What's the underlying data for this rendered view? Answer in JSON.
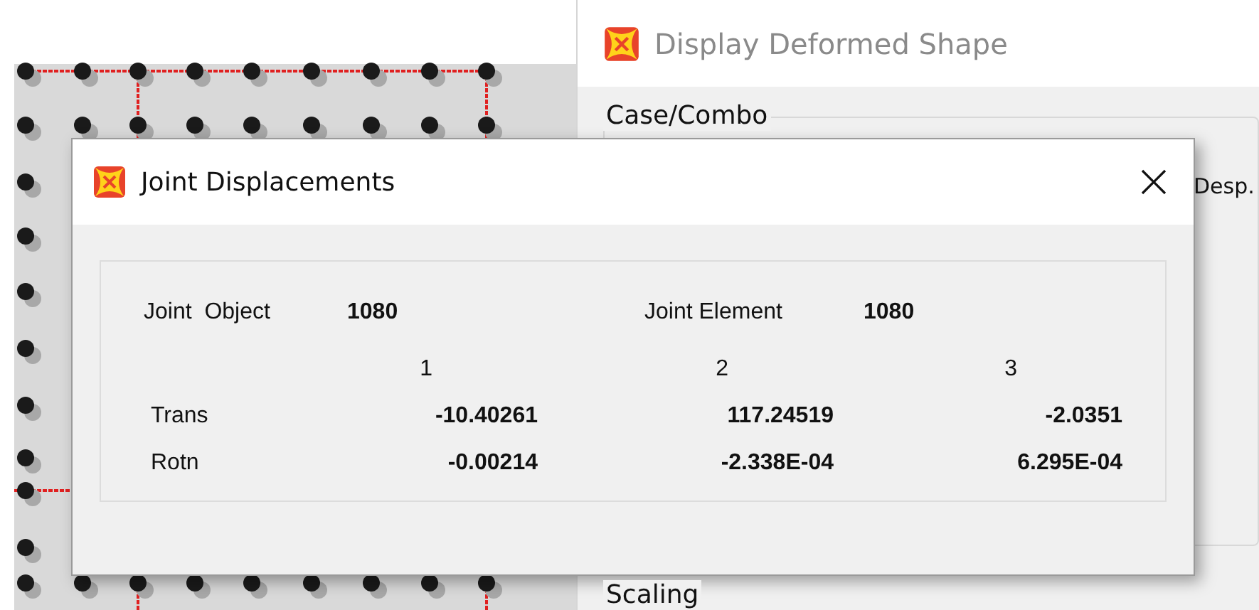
{
  "background_window": {
    "title": "Display Deformed Shape",
    "groups": [
      {
        "label": "Case/Combo"
      },
      {
        "label": "Scaling"
      }
    ],
    "partial_control": "Desp."
  },
  "dialog": {
    "title": "Joint Displacements",
    "joint_object_label": "Joint  Object",
    "joint_object": "1080",
    "joint_element_label": "Joint Element",
    "joint_element": "1080",
    "columns": [
      "1",
      "2",
      "3"
    ],
    "rows": [
      {
        "label": "Trans",
        "values": [
          "-10.40261",
          "117.24519",
          "-2.0351"
        ]
      },
      {
        "label": "Rotn",
        "values": [
          "-0.00214",
          "-2.338E-04",
          "6.295E-04"
        ]
      }
    ]
  }
}
